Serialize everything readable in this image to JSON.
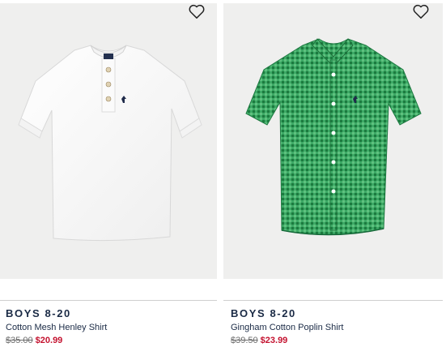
{
  "products": [
    {
      "category": "BOYS 8-20",
      "name": "Cotton Mesh Henley Shirt",
      "original_price": "$35.00",
      "sale_price": "$20.99",
      "image_icon": "white-henley-shirt",
      "favorite_icon": "heart-icon"
    },
    {
      "category": "BOYS 8-20",
      "name": "Gingham Cotton Poplin Shirt",
      "original_price": "$39.50",
      "sale_price": "$23.99",
      "image_icon": "green-gingham-shirt",
      "favorite_icon": "heart-icon"
    }
  ],
  "colors": {
    "image_bg": "#efefee",
    "text": "#1a2a45",
    "sale": "#c4122f",
    "strike": "#6b6b6b",
    "gingham": "#2e9e5a"
  }
}
